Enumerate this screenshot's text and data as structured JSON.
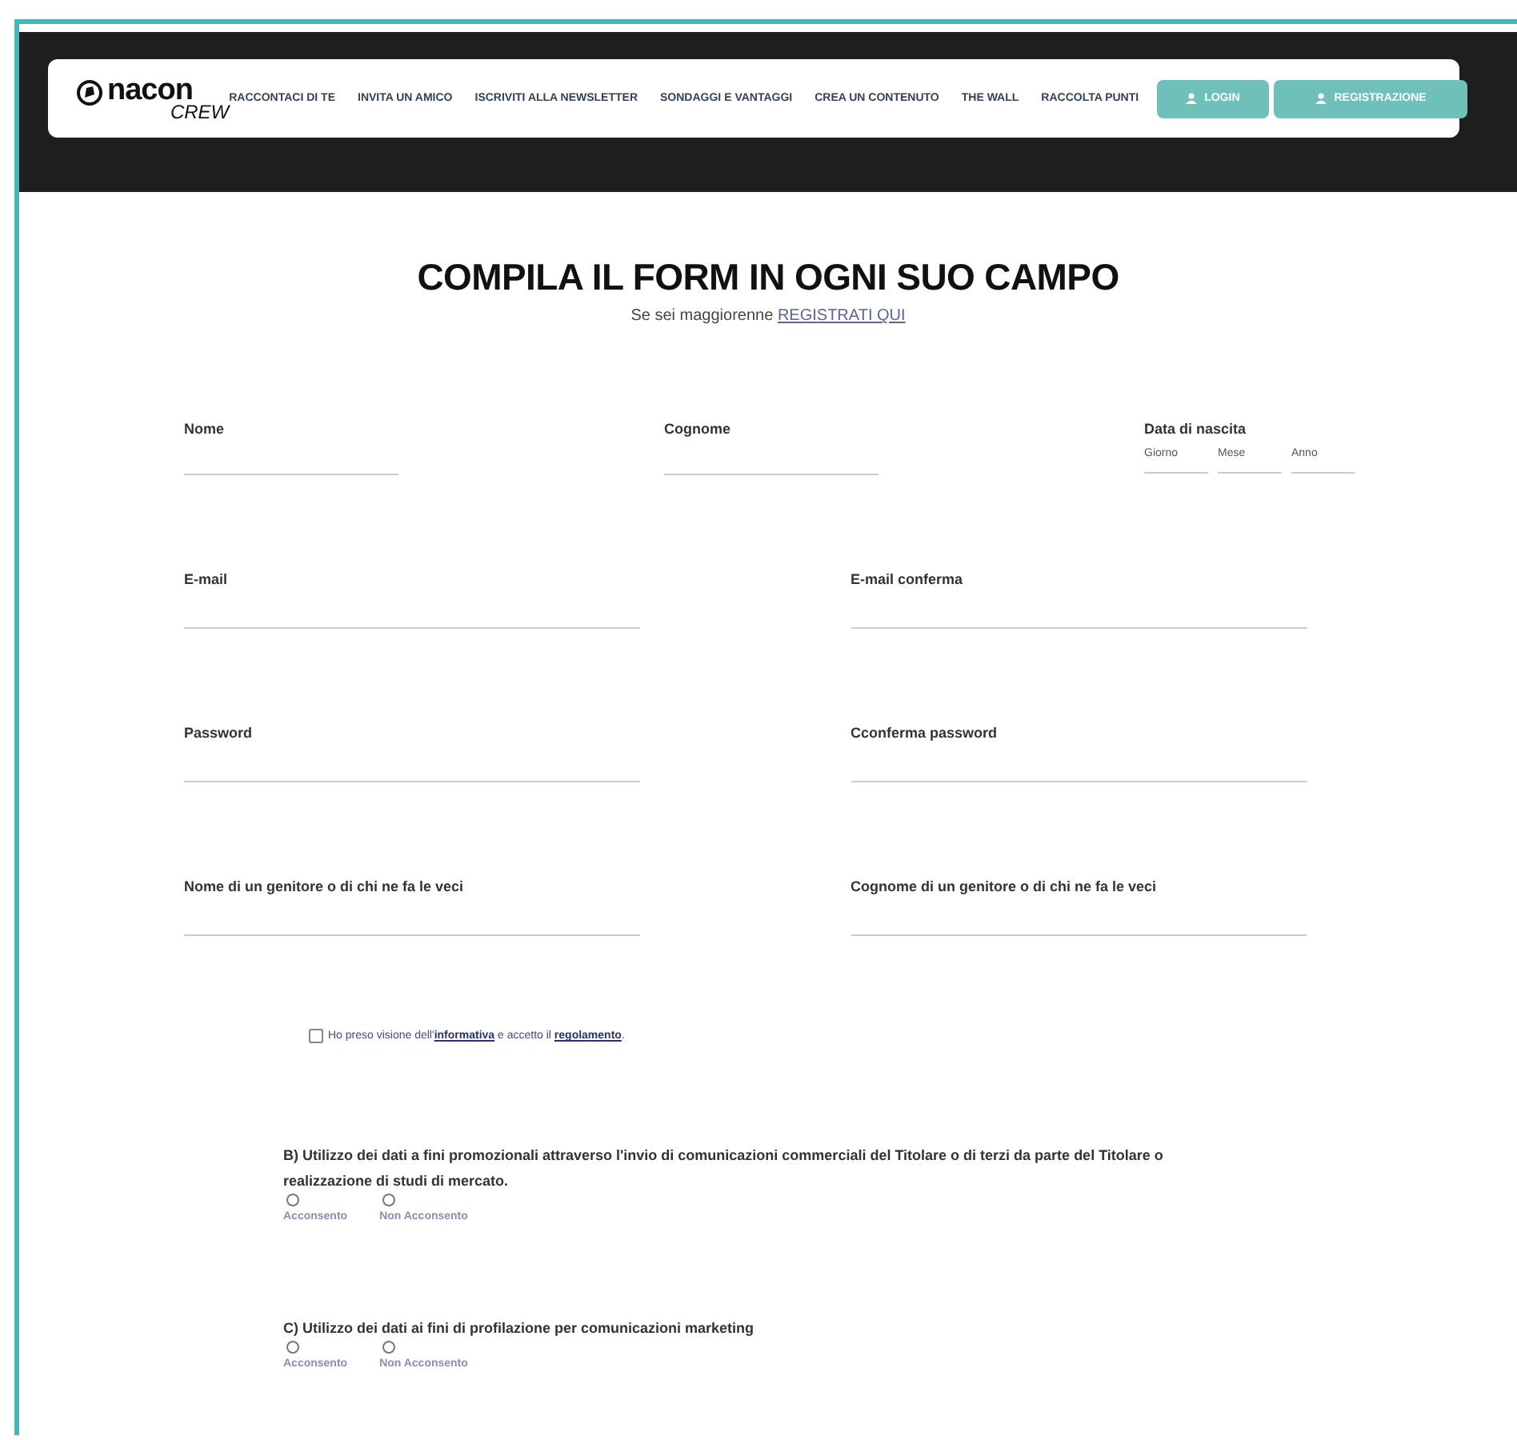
{
  "logo": {
    "brand": "nacon",
    "sub": "CREW"
  },
  "nav": {
    "links": [
      "RACCONTACI DI TE",
      "INVITA UN AMICO",
      "ISCRIVITI ALLA NEWSLETTER",
      "SONDAGGI E VANTAGGI",
      "CREA UN CONTENUTO",
      "THE WALL",
      "RACCOLTA PUNTI"
    ],
    "buttons": [
      "LOGIN",
      "REGISTRAZIONE"
    ]
  },
  "form": {
    "title": "COMPILA IL FORM IN OGNI SUO CAMPO",
    "subtitle": "Se sei maggiorenne",
    "subtitle_link": "REGISTRATI QUI",
    "row1": [
      {
        "label": "Nome"
      },
      {
        "label": "Cognome"
      }
    ],
    "birth": {
      "label": "Data di nascita",
      "parts": [
        "Giorno",
        "Mese",
        "Anno"
      ]
    },
    "rows": [
      [
        {
          "label": "E-mail"
        },
        {
          "label": "E-mail conferma"
        }
      ],
      [
        {
          "label": "Password"
        },
        {
          "label": "Cconferma password"
        }
      ],
      [
        {
          "label": "Nome di un genitore o di chi ne fa le veci"
        },
        {
          "label": "Cognome di un genitore o di chi ne fa le veci"
        }
      ]
    ],
    "consent": {
      "checked": false,
      "before": "Ho preso visione dell'",
      "link_1": "informativa",
      "middle": " e accetto il ",
      "link_2": "regolamento",
      "after": "."
    },
    "questions": [
      {
        "text": "B) Utilizzo dei dati a fini promozionali attraverso l'invio di comunicazioni commerciali del Titolare o di terzi da parte del Titolare o realizzazione di studi di mercato.",
        "options": [
          {
            "label": "Acconsento",
            "selected": false
          },
          {
            "label": "Non Acconsento",
            "selected": false
          }
        ]
      },
      {
        "text": "C) Utilizzo dei dati ai fini di profilazione per comunicazioni marketing",
        "options": [
          {
            "label": "Acconsento",
            "selected": false
          },
          {
            "label": "Non Acconsento",
            "selected": false
          }
        ]
      }
    ]
  }
}
